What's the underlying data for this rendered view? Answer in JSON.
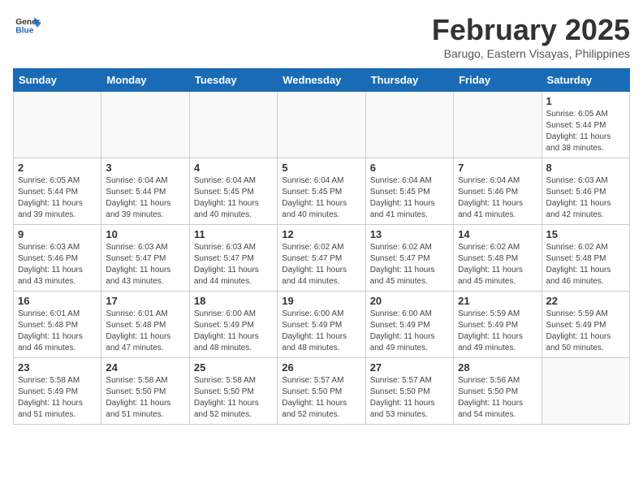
{
  "header": {
    "logo_line1": "General",
    "logo_line2": "Blue",
    "title": "February 2025",
    "subtitle": "Barugo, Eastern Visayas, Philippines"
  },
  "weekdays": [
    "Sunday",
    "Monday",
    "Tuesday",
    "Wednesday",
    "Thursday",
    "Friday",
    "Saturday"
  ],
  "weeks": [
    [
      {
        "day": "",
        "info": ""
      },
      {
        "day": "",
        "info": ""
      },
      {
        "day": "",
        "info": ""
      },
      {
        "day": "",
        "info": ""
      },
      {
        "day": "",
        "info": ""
      },
      {
        "day": "",
        "info": ""
      },
      {
        "day": "1",
        "info": "Sunrise: 6:05 AM\nSunset: 5:44 PM\nDaylight: 11 hours\nand 38 minutes."
      }
    ],
    [
      {
        "day": "2",
        "info": "Sunrise: 6:05 AM\nSunset: 5:44 PM\nDaylight: 11 hours\nand 39 minutes."
      },
      {
        "day": "3",
        "info": "Sunrise: 6:04 AM\nSunset: 5:44 PM\nDaylight: 11 hours\nand 39 minutes."
      },
      {
        "day": "4",
        "info": "Sunrise: 6:04 AM\nSunset: 5:45 PM\nDaylight: 11 hours\nand 40 minutes."
      },
      {
        "day": "5",
        "info": "Sunrise: 6:04 AM\nSunset: 5:45 PM\nDaylight: 11 hours\nand 40 minutes."
      },
      {
        "day": "6",
        "info": "Sunrise: 6:04 AM\nSunset: 5:45 PM\nDaylight: 11 hours\nand 41 minutes."
      },
      {
        "day": "7",
        "info": "Sunrise: 6:04 AM\nSunset: 5:46 PM\nDaylight: 11 hours\nand 41 minutes."
      },
      {
        "day": "8",
        "info": "Sunrise: 6:03 AM\nSunset: 5:46 PM\nDaylight: 11 hours\nand 42 minutes."
      }
    ],
    [
      {
        "day": "9",
        "info": "Sunrise: 6:03 AM\nSunset: 5:46 PM\nDaylight: 11 hours\nand 43 minutes."
      },
      {
        "day": "10",
        "info": "Sunrise: 6:03 AM\nSunset: 5:47 PM\nDaylight: 11 hours\nand 43 minutes."
      },
      {
        "day": "11",
        "info": "Sunrise: 6:03 AM\nSunset: 5:47 PM\nDaylight: 11 hours\nand 44 minutes."
      },
      {
        "day": "12",
        "info": "Sunrise: 6:02 AM\nSunset: 5:47 PM\nDaylight: 11 hours\nand 44 minutes."
      },
      {
        "day": "13",
        "info": "Sunrise: 6:02 AM\nSunset: 5:47 PM\nDaylight: 11 hours\nand 45 minutes."
      },
      {
        "day": "14",
        "info": "Sunrise: 6:02 AM\nSunset: 5:48 PM\nDaylight: 11 hours\nand 45 minutes."
      },
      {
        "day": "15",
        "info": "Sunrise: 6:02 AM\nSunset: 5:48 PM\nDaylight: 11 hours\nand 46 minutes."
      }
    ],
    [
      {
        "day": "16",
        "info": "Sunrise: 6:01 AM\nSunset: 5:48 PM\nDaylight: 11 hours\nand 46 minutes."
      },
      {
        "day": "17",
        "info": "Sunrise: 6:01 AM\nSunset: 5:48 PM\nDaylight: 11 hours\nand 47 minutes."
      },
      {
        "day": "18",
        "info": "Sunrise: 6:00 AM\nSunset: 5:49 PM\nDaylight: 11 hours\nand 48 minutes."
      },
      {
        "day": "19",
        "info": "Sunrise: 6:00 AM\nSunset: 5:49 PM\nDaylight: 11 hours\nand 48 minutes."
      },
      {
        "day": "20",
        "info": "Sunrise: 6:00 AM\nSunset: 5:49 PM\nDaylight: 11 hours\nand 49 minutes."
      },
      {
        "day": "21",
        "info": "Sunrise: 5:59 AM\nSunset: 5:49 PM\nDaylight: 11 hours\nand 49 minutes."
      },
      {
        "day": "22",
        "info": "Sunrise: 5:59 AM\nSunset: 5:49 PM\nDaylight: 11 hours\nand 50 minutes."
      }
    ],
    [
      {
        "day": "23",
        "info": "Sunrise: 5:58 AM\nSunset: 5:49 PM\nDaylight: 11 hours\nand 51 minutes."
      },
      {
        "day": "24",
        "info": "Sunrise: 5:58 AM\nSunset: 5:50 PM\nDaylight: 11 hours\nand 51 minutes."
      },
      {
        "day": "25",
        "info": "Sunrise: 5:58 AM\nSunset: 5:50 PM\nDaylight: 11 hours\nand 52 minutes."
      },
      {
        "day": "26",
        "info": "Sunrise: 5:57 AM\nSunset: 5:50 PM\nDaylight: 11 hours\nand 52 minutes."
      },
      {
        "day": "27",
        "info": "Sunrise: 5:57 AM\nSunset: 5:50 PM\nDaylight: 11 hours\nand 53 minutes."
      },
      {
        "day": "28",
        "info": "Sunrise: 5:56 AM\nSunset: 5:50 PM\nDaylight: 11 hours\nand 54 minutes."
      },
      {
        "day": "",
        "info": ""
      }
    ]
  ]
}
